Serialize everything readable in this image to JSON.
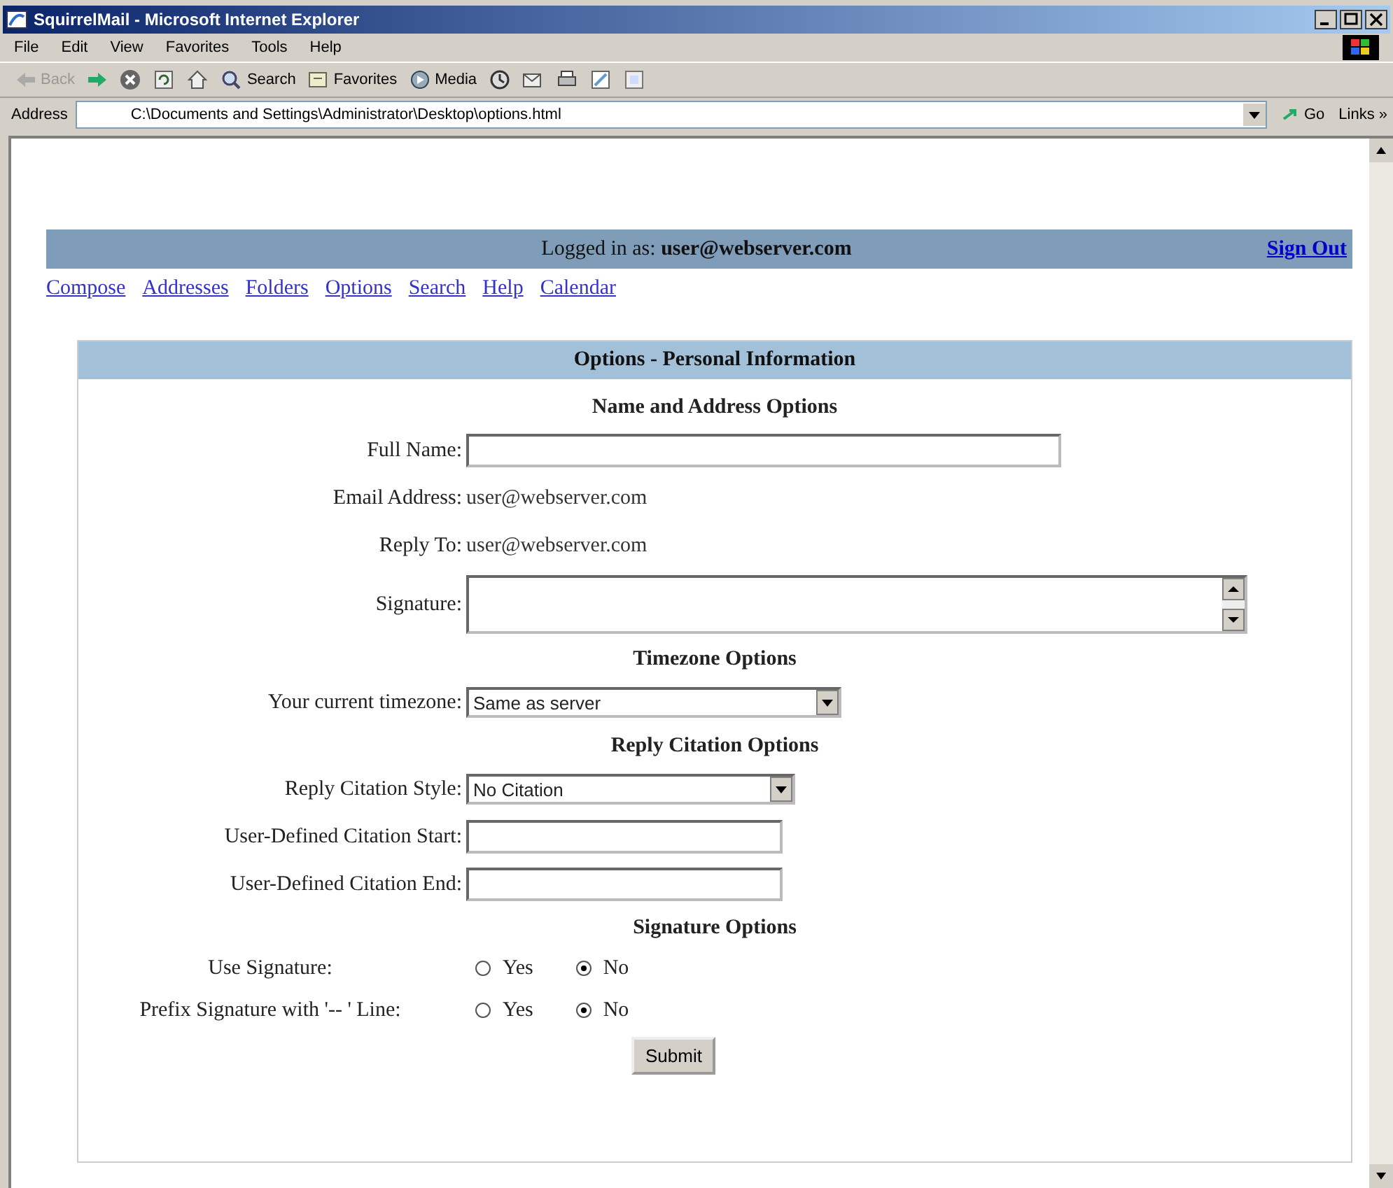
{
  "window": {
    "title": "SquirrelMail - Microsoft Internet Explorer"
  },
  "menu": [
    "File",
    "Edit",
    "View",
    "Favorites",
    "Tools",
    "Help"
  ],
  "toolbar": [
    {
      "kind": "back",
      "label": "Back",
      "disabled": true
    },
    {
      "kind": "forward",
      "disabled": false
    },
    {
      "kind": "stop",
      "disabled": false
    },
    {
      "kind": "refresh",
      "disabled": false
    },
    {
      "kind": "home",
      "disabled": false
    },
    {
      "kind": "search",
      "label": "Search",
      "disabled": false
    },
    {
      "kind": "favorites",
      "label": "Favorites",
      "disabled": false
    },
    {
      "kind": "media",
      "label": "Media",
      "disabled": false
    },
    {
      "kind": "history",
      "disabled": false
    },
    {
      "kind": "mail",
      "disabled": false
    },
    {
      "kind": "print",
      "disabled": false
    },
    {
      "kind": "edit",
      "disabled": false
    },
    {
      "kind": "discuss",
      "disabled": false
    }
  ],
  "address": {
    "label": "Address",
    "value": "C:\\Documents and Settings\\Administrator\\Desktop\\options.html",
    "go": "Go",
    "links": "Links »"
  },
  "page": {
    "login_text": "Logged in as: **user@webserver.com**",
    "sign_out": "Sign Out",
    "nav": [
      "Compose",
      "Addresses",
      "Folders",
      "Options",
      "Search",
      "Help",
      "Calendar"
    ],
    "panel_title": "Options - Personal Information",
    "rows": [
      {
        "kind": "heading",
        "text": "Name and Address Options"
      },
      {
        "kind": "longtext",
        "label": "Full Name:"
      },
      {
        "kind": "static",
        "label": "Email Address:",
        "value": "user@webserver.com"
      },
      {
        "kind": "static",
        "label": "Reply To:",
        "value": "user@webserver.com"
      },
      {
        "kind": "textarea",
        "label": "Signature:"
      },
      {
        "kind": "heading",
        "text": "Timezone Options"
      },
      {
        "kind": "longselect",
        "label": "Your current timezone:",
        "value": "Same as server"
      },
      {
        "kind": "heading",
        "text": "Reply Citation Options"
      },
      {
        "kind": "shortselect",
        "label": "Reply Citation Style:",
        "value": "No Citation"
      },
      {
        "kind": "shorttext",
        "label": "User-Defined Citation Start:"
      },
      {
        "kind": "shorttext",
        "label": "User-Defined Citation End:"
      },
      {
        "kind": "heading",
        "text": "Signature Options"
      },
      {
        "kind": "radio",
        "label": "Use Signature:",
        "options": [
          {
            "label": "Yes",
            "selected": false
          },
          {
            "label": "No",
            "selected": true
          }
        ]
      },
      {
        "kind": "radio",
        "label": "Prefix Signature with '-- ' Line:",
        "options": [
          {
            "label": "Yes",
            "selected": false
          },
          {
            "label": "No",
            "selected": true
          }
        ]
      },
      {
        "kind": "submit",
        "label": "Submit"
      }
    ]
  }
}
